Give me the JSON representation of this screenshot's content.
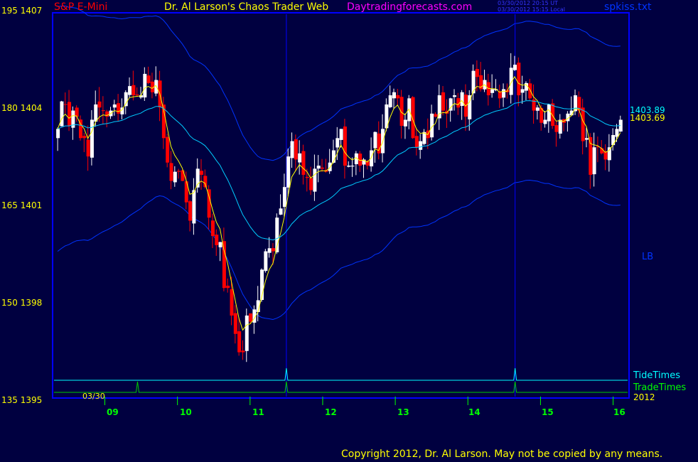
{
  "header": {
    "symbol": "S&P E-Mini",
    "title": "Dr. Al Larson's Chaos Trader Web",
    "site": "Daytradingforecasts.com",
    "timestamp_ut": "03/30/2012 20:15 UT",
    "timestamp_local": "03/30/2012 15:15 Local",
    "filename": "spkiss.txt"
  },
  "copyright": "Copyright 2012, Dr. Al Larson. May not be copied by any means.",
  "colors": {
    "background": "#000040",
    "frame": "#0000ff",
    "up_candle": "#ffffff",
    "down_candle": "#ff0000",
    "fast_ma": "#ffff00",
    "slow_ma": "#00ccff",
    "bands": "#0033ff",
    "tide": "#00ffff",
    "trade": "#00cc00"
  },
  "chart_data": {
    "type": "candlestick",
    "title": "S&P E-Mini",
    "y_axis": {
      "ticks": [
        {
          "label": "195  1407",
          "value": 1407
        },
        {
          "label": "180  1404",
          "value": 1404
        },
        {
          "label": "165  1401",
          "value": 1401
        },
        {
          "label": "150  1398",
          "value": 1398
        },
        {
          "label": "135  1395",
          "value": 1395
        }
      ],
      "range": [
        1394.75,
        1407.25
      ]
    },
    "x_axis": {
      "ticks": [
        "09",
        "10",
        "11",
        "12",
        "13",
        "14",
        "15",
        "16"
      ],
      "tick_hours": [
        9,
        10,
        11,
        12,
        13,
        14,
        15,
        16
      ],
      "range_hours": [
        8.3,
        16.2
      ],
      "date_label": "03/30",
      "year_label": "2012"
    },
    "price_labels": [
      {
        "text": "1403.89",
        "value": 1403.89,
        "color": "#00ffff"
      },
      {
        "text": "1403.69",
        "value": 1403.69,
        "color": "#ffff00"
      }
    ],
    "lb_label": "LB",
    "vertical_markers_hours": [
      11.5,
      14.65
    ],
    "legend": {
      "tide": "TideTimes",
      "trade": "TradeTimes"
    },
    "tide_spikes_hours": [
      11.5,
      14.65
    ],
    "trade_spikes_hours": [
      9.45,
      11.5,
      14.65
    ],
    "candles_close": [
      1403.5,
      1404.4,
      1404.3,
      1403.6,
      1404.1,
      1403.9,
      1403.2,
      1403.2,
      1402.6,
      1403.8,
      1404.3,
      1404.2,
      1404.1,
      1403.9,
      1404.1,
      1404.3,
      1404.0,
      1404.2,
      1404.7,
      1404.9,
      1404.6,
      1404.6,
      1404.6,
      1405.3,
      1405.0,
      1404.7,
      1405.1,
      1404.2,
      1403.2,
      1402.4,
      1401.8,
      1402.1,
      1402.1,
      1401.8,
      1401.1,
      1400.5,
      1401.5,
      1402.2,
      1402.0,
      1401.6,
      1400.6,
      1400.0,
      1399.7,
      1399.8,
      1398.3,
      1398.3,
      1397.4,
      1396.8,
      1396.2,
      1396.2,
      1397.4,
      1397.2,
      1397.6,
      1397.9,
      1398.9,
      1399.5,
      1399.6,
      1399.5,
      1400.6,
      1400.9,
      1401.6,
      1402.6,
      1403.1,
      1402.5,
      1402.7,
      1402.0,
      1401.9,
      1401.5,
      1402.2,
      1402.3,
      1402.2,
      1402.1,
      1402.4,
      1402.8,
      1403.2,
      1403.5,
      1402.3,
      1402.3,
      1402.3,
      1402.7,
      1402.3,
      1402.5,
      1402.3,
      1402.8,
      1403.4,
      1402.7,
      1403.5,
      1404.3,
      1404.6,
      1404.7,
      1404.5,
      1403.6,
      1403.8,
      1404.5,
      1403.2,
      1402.9,
      1403.1,
      1403.4,
      1403.2,
      1404.0,
      1403.9,
      1404.6,
      1404.1,
      1404.0,
      1404.5,
      1404.6,
      1404.2,
      1404.7,
      1403.9,
      1404.6,
      1405.4,
      1405.2,
      1404.8,
      1405.1,
      1404.6,
      1404.8,
      1404.8,
      1404.5,
      1404.8,
      1404.7,
      1405.5,
      1405.6,
      1404.6,
      1404.8,
      1405.0,
      1404.5,
      1404.1,
      1404.2,
      1403.7,
      1403.8,
      1404.3,
      1403.6,
      1403.4,
      1403.8,
      1403.7,
      1404.0,
      1404.1,
      1404.6,
      1404.1,
      1403.1,
      1403.2,
      1402.0,
      1402.9,
      1402.9,
      1402.7,
      1402.5,
      1402.9,
      1403.3,
      1403.5,
      1403.8
    ]
  }
}
